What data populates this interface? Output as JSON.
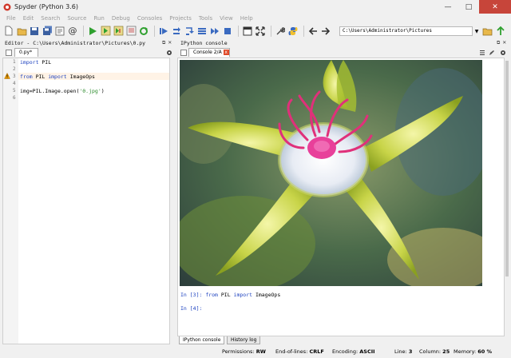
{
  "window": {
    "title": "Spyder (Python 3.6)",
    "min": "—",
    "max": "□",
    "close": "✕"
  },
  "menu": [
    "File",
    "Edit",
    "Search",
    "Source",
    "Run",
    "Debug",
    "Consoles",
    "Projects",
    "Tools",
    "View",
    "Help"
  ],
  "toolbar": {
    "path": "C:\\Users\\Administrator\\Pictures",
    "path_drop": "▼"
  },
  "editor": {
    "header": "Editor - C:\\Users\\Administrator\\Pictures\\0.py",
    "tab_label": "0.py*",
    "tab_close": "x",
    "lines": [
      {
        "n": "1",
        "parts": [
          {
            "t": "import",
            "k": "kw"
          },
          {
            "t": " PIL",
            "k": ""
          }
        ]
      },
      {
        "n": "2",
        "parts": []
      },
      {
        "n": "3",
        "parts": [
          {
            "t": "from",
            "k": "kw"
          },
          {
            "t": " PIL ",
            "k": ""
          },
          {
            "t": "import",
            "k": "kw"
          },
          {
            "t": " ImageOps",
            "k": ""
          }
        ]
      },
      {
        "n": "4",
        "parts": []
      },
      {
        "n": "5",
        "parts": [
          {
            "t": "img=PIL.Image.open(",
            "k": ""
          },
          {
            "t": "'0.jpg'",
            "k": "str"
          },
          {
            "t": ")",
            "k": ""
          }
        ]
      },
      {
        "n": "6",
        "parts": []
      }
    ]
  },
  "console": {
    "header": "IPython console",
    "tab_label": "Console 2/A",
    "tab_close": "x",
    "in3_prompt": "In [3]: ",
    "in3_from": "from",
    "in3_mid": " PIL ",
    "in3_import": "import",
    "in3_end": " ImageOps",
    "in4_prompt": "In [4]:"
  },
  "bottom_tabs": {
    "ipython": "IPython console",
    "history": "History log"
  },
  "status": {
    "permissions_label": "Permissions:",
    "permissions_value": "RW",
    "eol_label": "End-of-lines:",
    "eol_value": "CRLF",
    "encoding_label": "Encoding:",
    "encoding_value": "ASCII",
    "line_label": "Line:",
    "line_value": "3",
    "column_label": "Column:",
    "column_value": "25",
    "memory_label": "Memory:",
    "memory_value": "60 %"
  },
  "colors": {
    "keyword": "#1a3fbf",
    "string": "#2a8a2a",
    "prompt": "#1a3fbf",
    "warning": "#f0a000",
    "close_badge": "#e04a2a"
  }
}
